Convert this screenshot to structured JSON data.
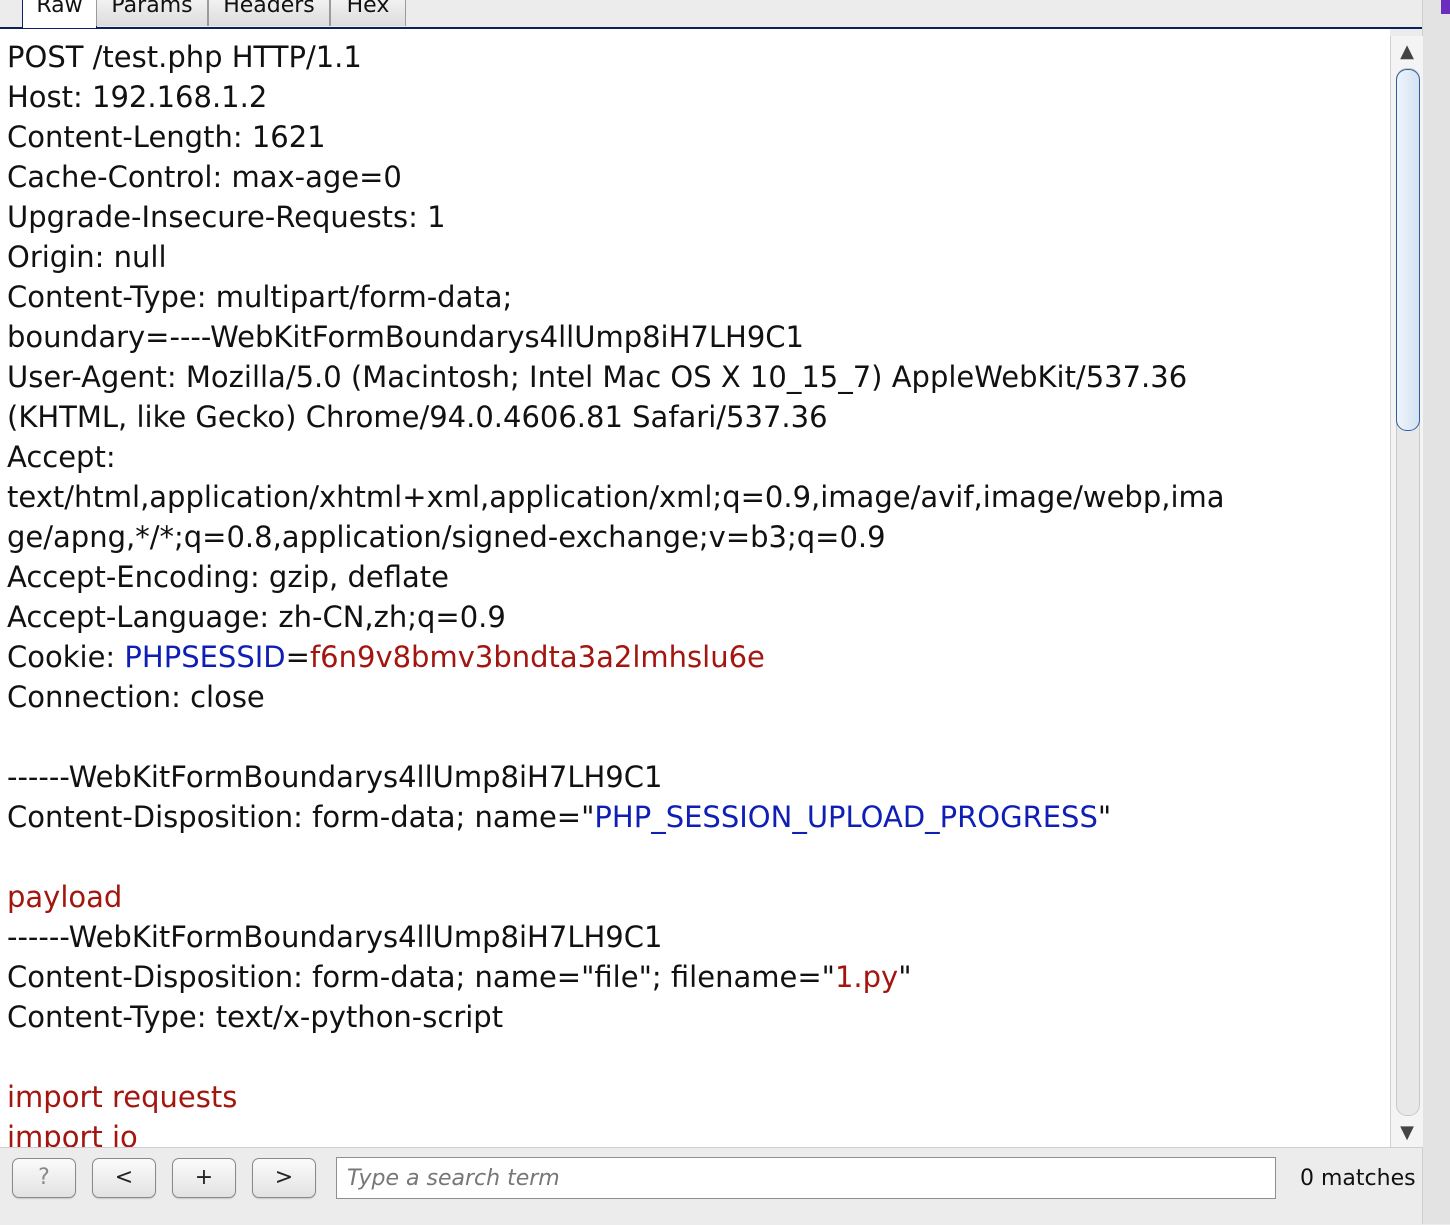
{
  "tabs": [
    {
      "label": "Raw",
      "active": true
    },
    {
      "label": "Params",
      "active": false
    },
    {
      "label": "Headers",
      "active": false
    },
    {
      "label": "Hex",
      "active": false
    }
  ],
  "request_lines": [
    {
      "segments": [
        {
          "text": "POST /test.php HTTP/1.1",
          "style": "plain"
        }
      ]
    },
    {
      "segments": [
        {
          "text": "Host: 192.168.1.2",
          "style": "plain"
        }
      ]
    },
    {
      "segments": [
        {
          "text": "Content-Length: 1621",
          "style": "plain"
        }
      ]
    },
    {
      "segments": [
        {
          "text": "Cache-Control: max-age=0",
          "style": "plain"
        }
      ]
    },
    {
      "segments": [
        {
          "text": "Upgrade-Insecure-Requests: 1",
          "style": "plain"
        }
      ]
    },
    {
      "segments": [
        {
          "text": "Origin: null",
          "style": "plain"
        }
      ]
    },
    {
      "segments": [
        {
          "text": "Content-Type: multipart/form-data;",
          "style": "plain"
        }
      ]
    },
    {
      "segments": [
        {
          "text": "boundary=----WebKitFormBoundarys4llUmp8iH7LH9C1",
          "style": "plain"
        }
      ]
    },
    {
      "segments": [
        {
          "text": "User-Agent: Mozilla/5.0 (Macintosh; Intel Mac OS X 10_15_7) AppleWebKit/537.36",
          "style": "plain"
        }
      ]
    },
    {
      "segments": [
        {
          "text": "(KHTML, like Gecko) Chrome/94.0.4606.81 Safari/537.36",
          "style": "plain"
        }
      ]
    },
    {
      "segments": [
        {
          "text": "Accept:",
          "style": "plain"
        }
      ]
    },
    {
      "segments": [
        {
          "text": "text/html,application/xhtml+xml,application/xml;q=0.9,image/avif,image/webp,ima",
          "style": "plain"
        }
      ]
    },
    {
      "segments": [
        {
          "text": "ge/apng,*/*;q=0.8,application/signed-exchange;v=b3;q=0.9",
          "style": "plain"
        }
      ]
    },
    {
      "segments": [
        {
          "text": "Accept-Encoding: gzip, deflate",
          "style": "plain"
        }
      ]
    },
    {
      "segments": [
        {
          "text": "Accept-Language: zh-CN,zh;q=0.9",
          "style": "plain"
        }
      ]
    },
    {
      "segments": [
        {
          "text": "Cookie: ",
          "style": "plain"
        },
        {
          "text": "PHPSESSID",
          "style": "blue"
        },
        {
          "text": "=",
          "style": "plain"
        },
        {
          "text": "f6n9v8bmv3bndta3a2lmhslu6e",
          "style": "red"
        }
      ]
    },
    {
      "segments": [
        {
          "text": "Connection: close",
          "style": "plain"
        }
      ]
    },
    {
      "segments": [
        {
          "text": "",
          "style": "plain"
        }
      ]
    },
    {
      "segments": [
        {
          "text": "------WebKitFormBoundarys4llUmp8iH7LH9C1",
          "style": "plain"
        }
      ]
    },
    {
      "segments": [
        {
          "text": "Content-Disposition: form-data; name=\"",
          "style": "plain"
        },
        {
          "text": "PHP_SESSION_UPLOAD_PROGRESS",
          "style": "blue"
        },
        {
          "text": "\"",
          "style": "plain"
        }
      ]
    },
    {
      "segments": [
        {
          "text": "",
          "style": "plain"
        }
      ]
    },
    {
      "segments": [
        {
          "text": "payload",
          "style": "red"
        }
      ]
    },
    {
      "segments": [
        {
          "text": "------WebKitFormBoundarys4llUmp8iH7LH9C1",
          "style": "plain"
        }
      ]
    },
    {
      "segments": [
        {
          "text": "Content-Disposition: form-data; name=\"file\"; filename=\"",
          "style": "plain"
        },
        {
          "text": "1.py",
          "style": "red"
        },
        {
          "text": "\"",
          "style": "plain"
        }
      ]
    },
    {
      "segments": [
        {
          "text": "Content-Type: text/x-python-script",
          "style": "plain"
        }
      ]
    },
    {
      "segments": [
        {
          "text": "",
          "style": "plain"
        }
      ]
    },
    {
      "segments": [
        {
          "text": "import requests",
          "style": "red"
        }
      ]
    },
    {
      "segments": [
        {
          "text": "import io",
          "style": "red"
        }
      ]
    }
  ],
  "scrollbar": {
    "up_glyph": "▲",
    "down_glyph": "▼",
    "position_fraction": 0.0
  },
  "searchbar": {
    "help_label": "?",
    "prev_label": "<",
    "add_label": "+",
    "next_label": ">",
    "placeholder": "Type a search term",
    "value": "",
    "matches": "0 matches"
  },
  "colors": {
    "keyword_blue": "#0f1fb5",
    "value_red": "#a3160f",
    "accent_purple": "#6a2dbd"
  }
}
